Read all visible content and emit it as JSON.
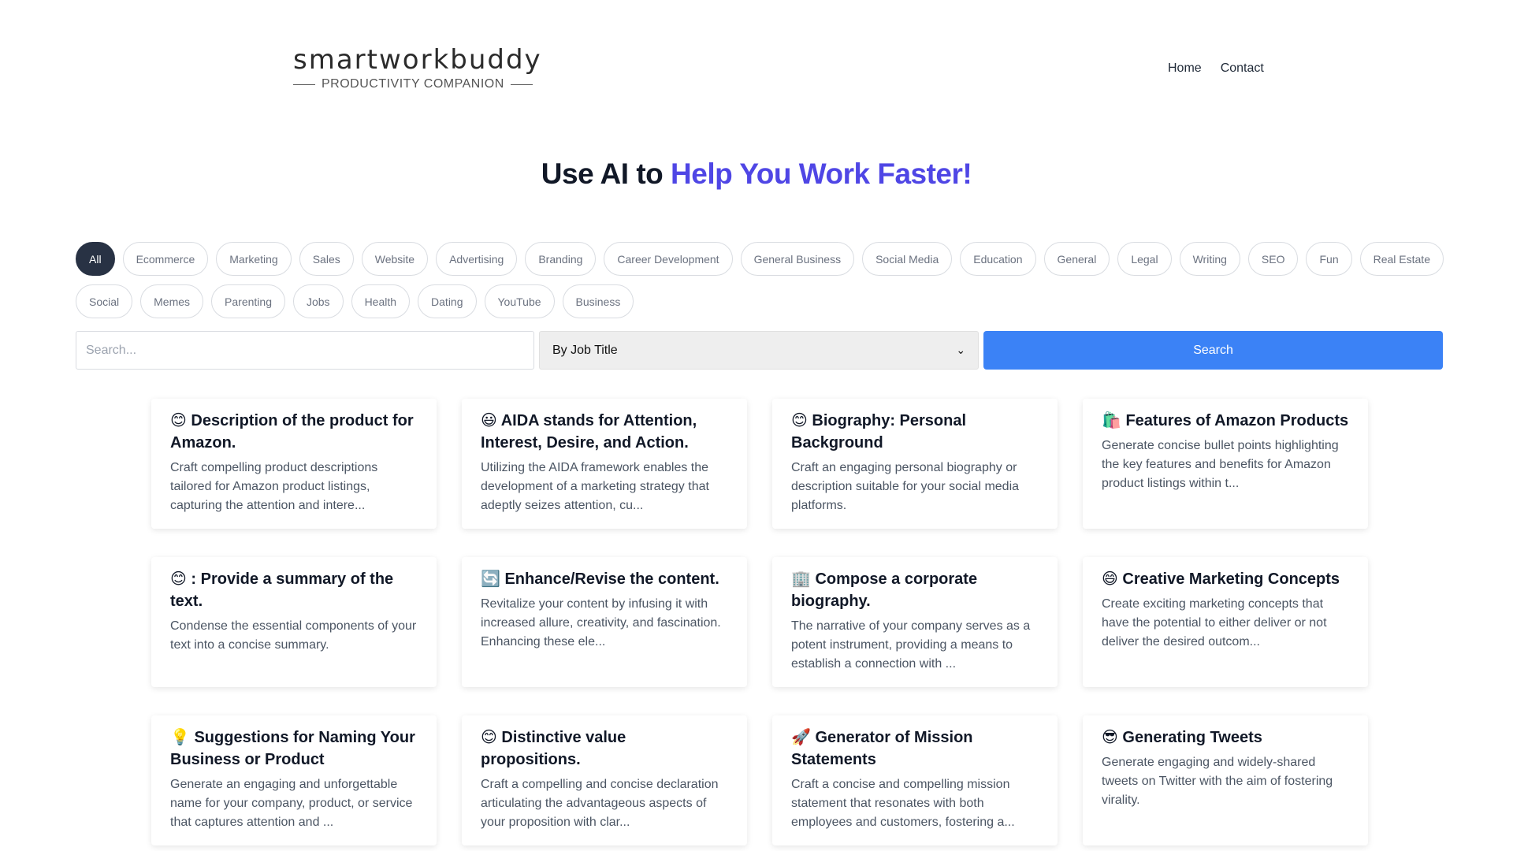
{
  "brand": {
    "name": "smartworkbuddy",
    "tagline": "PRODUCTIVITY COMPANION"
  },
  "nav": {
    "items": [
      "Home",
      "Contact"
    ]
  },
  "hero": {
    "lead": "Use AI to ",
    "accent": "Help You Work Faster!",
    "accent_color": "#4f46e5"
  },
  "categories": {
    "active": "All",
    "items": [
      "All",
      "Ecommerce",
      "Marketing",
      "Sales",
      "Website",
      "Advertising",
      "Branding",
      "Career Development",
      "General Business",
      "Social Media",
      "Education",
      "General",
      "Legal",
      "Writing",
      "SEO",
      "Fun",
      "Real Estate",
      "Social",
      "Memes",
      "Parenting",
      "Jobs",
      "Health",
      "Dating",
      "YouTube",
      "Business"
    ]
  },
  "search": {
    "placeholder": "Search...",
    "value": "",
    "filter_selected": "By Job Title",
    "button_label": "Search",
    "button_color": "#3b82f6"
  },
  "cards": [
    {
      "icon": "😊",
      "title": "Description of the product for Amazon.",
      "desc": "Craft compelling product descriptions tailored for Amazon product listings, capturing the attention and intere..."
    },
    {
      "icon": "😃",
      "title": "AIDA stands for Attention, Interest, Desire, and Action.",
      "desc": "Utilizing the AIDA framework enables the development of a marketing strategy that adeptly seizes attention, cu..."
    },
    {
      "icon": "😊",
      "title": "Biography: Personal Background",
      "desc": "Craft an engaging personal biography or description suitable for your social media platforms."
    },
    {
      "icon": "🛍️",
      "title": "Features of Amazon Products",
      "desc": "Generate concise bullet points highlighting the key features and benefits for Amazon product listings within t..."
    },
    {
      "icon": "😊",
      "title": ": Provide a summary of the text.",
      "desc": "Condense the essential components of your text into a concise summary."
    },
    {
      "icon": "🔄",
      "title": "Enhance/Revise the content.",
      "desc": "Revitalize your content by infusing it with increased allure, creativity, and fascination. Enhancing these ele..."
    },
    {
      "icon": "🏢",
      "title": "Compose a corporate biography.",
      "desc": "The narrative of your company serves as a potent instrument, providing a means to establish a connection with ..."
    },
    {
      "icon": "😄",
      "title": "Creative Marketing Concepts",
      "desc": "Create exciting marketing concepts that have the potential to either deliver or not deliver the desired outcom..."
    },
    {
      "icon": "💡",
      "title": "Suggestions for Naming Your Business or Product",
      "desc": "Generate an engaging and unforgettable name for your company, product, or service that captures attention and ..."
    },
    {
      "icon": "😊",
      "title": "Distinctive value propositions.",
      "desc": "Craft a compelling and concise declaration articulating the advantageous aspects of your proposition with clar..."
    },
    {
      "icon": "🚀",
      "title": "Generator of Mission Statements",
      "desc": "Craft a concise and compelling mission statement that resonates with both employees and customers, fostering a..."
    },
    {
      "icon": "😎",
      "title": "Generating Tweets",
      "desc": "Generate engaging and widely-shared tweets on Twitter with the aim of fostering virality."
    }
  ]
}
